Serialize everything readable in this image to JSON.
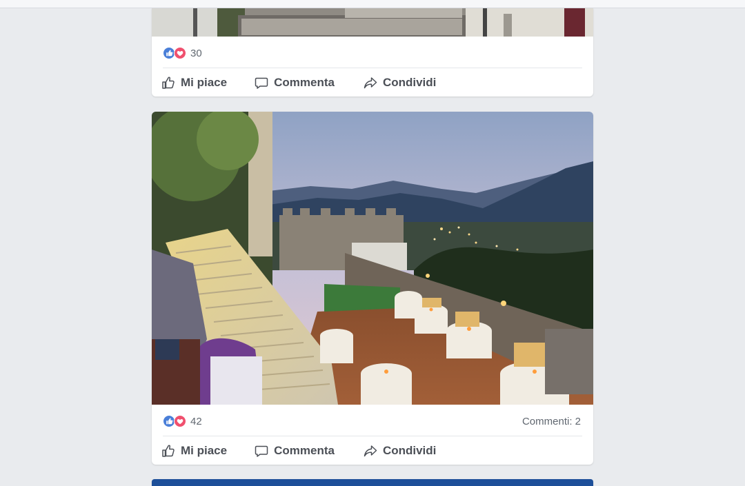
{
  "posts": [
    {
      "reactions_count": "30",
      "comments_label": "",
      "actions": {
        "like": "Mi piace",
        "comment": "Commenta",
        "share": "Condividi"
      }
    },
    {
      "reactions_count": "42",
      "comments_label": "Commenti: 2",
      "actions": {
        "like": "Mi piace",
        "comment": "Commenta",
        "share": "Condividi"
      }
    }
  ],
  "icons": {
    "like_reaction": "thumbs-up-icon",
    "love_reaction": "heart-icon",
    "like_action": "thumb-outline-icon",
    "comment_action": "speech-bubble-icon",
    "share_action": "share-arrow-icon"
  },
  "colors": {
    "like_blue": "#4a7fd8",
    "love_red": "#f0506e",
    "action_text": "#4b4f56",
    "meta_text": "#606770"
  }
}
